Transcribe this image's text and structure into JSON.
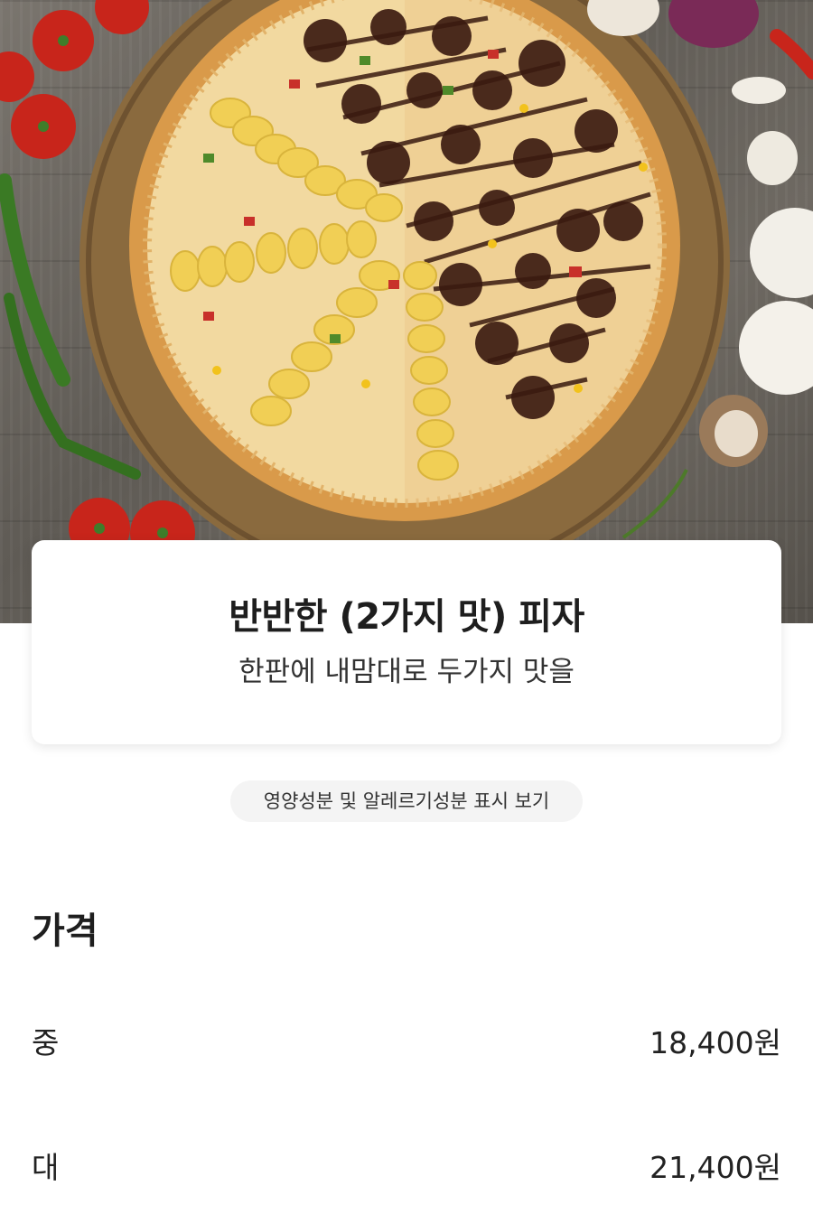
{
  "hero": {
    "image_name": "pizza-photo",
    "colors": {
      "wood_table": "#6b6660",
      "board": "#8a6a3e",
      "crust": "#d99a4a",
      "cheese": "#f2d9a0",
      "potato": "#f1cf55",
      "beef": "#4a2a1c"
    }
  },
  "product": {
    "title": "반반한 (2가지 맛) 피자",
    "subtitle": "한판에 내맘대로 두가지 맛을"
  },
  "nutrition_button": {
    "label": "영양성분 및 알레르기성분 표시 보기"
  },
  "price": {
    "heading": "가격",
    "rows": [
      {
        "size": "중",
        "amount": "18,400원"
      },
      {
        "size": "대",
        "amount": "21,400원"
      }
    ]
  }
}
